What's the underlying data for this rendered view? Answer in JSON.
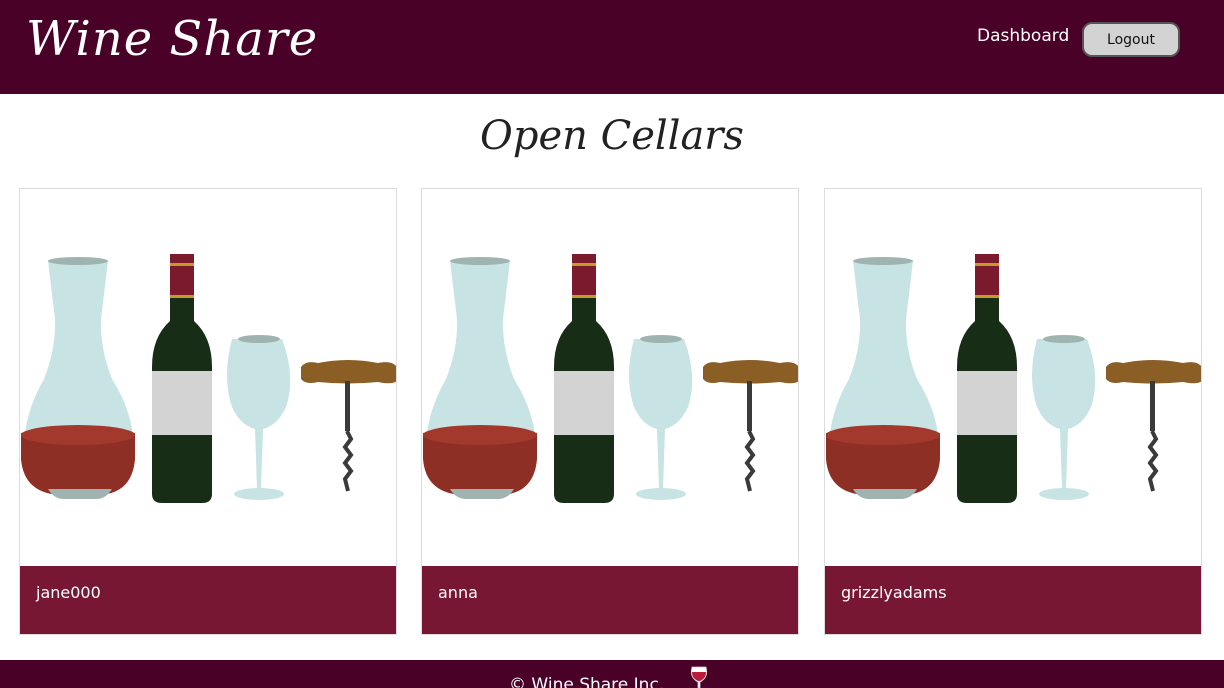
{
  "navbar": {
    "brand": "Wine Share",
    "links": [
      {
        "label": "Dashboard"
      }
    ],
    "logout_label": "Logout"
  },
  "main": {
    "title": "Open Cellars",
    "cellars": [
      {
        "username": "jane000",
        "image": "wine-accessories-illustration"
      },
      {
        "username": "anna",
        "image": "wine-accessories-illustration"
      },
      {
        "username": "grizzlyadams",
        "image": "wine-accessories-illustration"
      }
    ]
  },
  "footer": {
    "text": "© Wine Share Inc.",
    "icon": "wine-glass-icon"
  },
  "colors": {
    "navbar_bg": "#4a0128",
    "card_footer_bg": "#781733",
    "button_bg": "#d3d3d3"
  }
}
